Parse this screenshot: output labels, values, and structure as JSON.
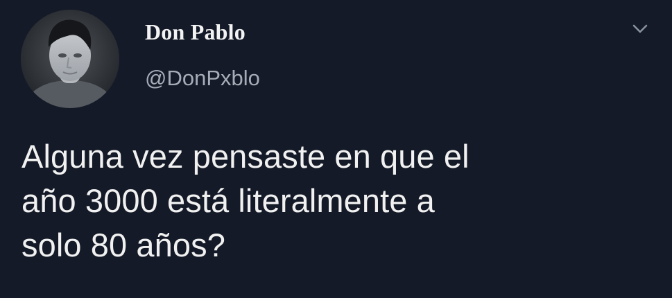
{
  "author": {
    "display_name": "Don Pablo",
    "handle": "@DonPxblo"
  },
  "icons": {
    "avatar": "profile-photo",
    "menu": "chevron-down-icon"
  },
  "tweet": {
    "lines": [
      "Alguna vez pensaste en que el",
      "año 3000 está literalmente a",
      "solo 80 años?"
    ]
  },
  "colors": {
    "background": "#141a27",
    "name": "#f3f3f3",
    "handle": "#a6adb8",
    "text": "#f1f1f1"
  }
}
